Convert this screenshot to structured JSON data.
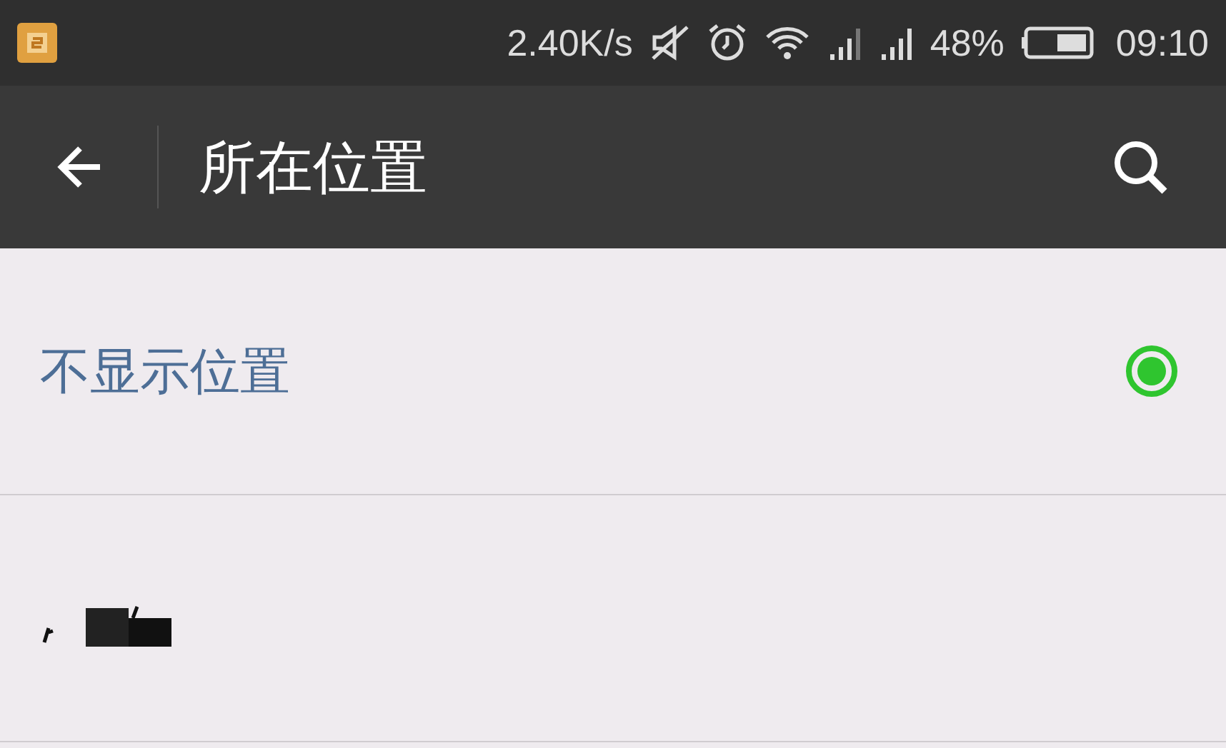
{
  "status_bar": {
    "speed": "2.40K/s",
    "battery_percent": "48%",
    "time": "09:10"
  },
  "app_bar": {
    "title": "所在位置"
  },
  "rows": [
    {
      "kind": "option",
      "label": "不显示位置",
      "selected": true
    },
    {
      "kind": "redacted"
    }
  ]
}
